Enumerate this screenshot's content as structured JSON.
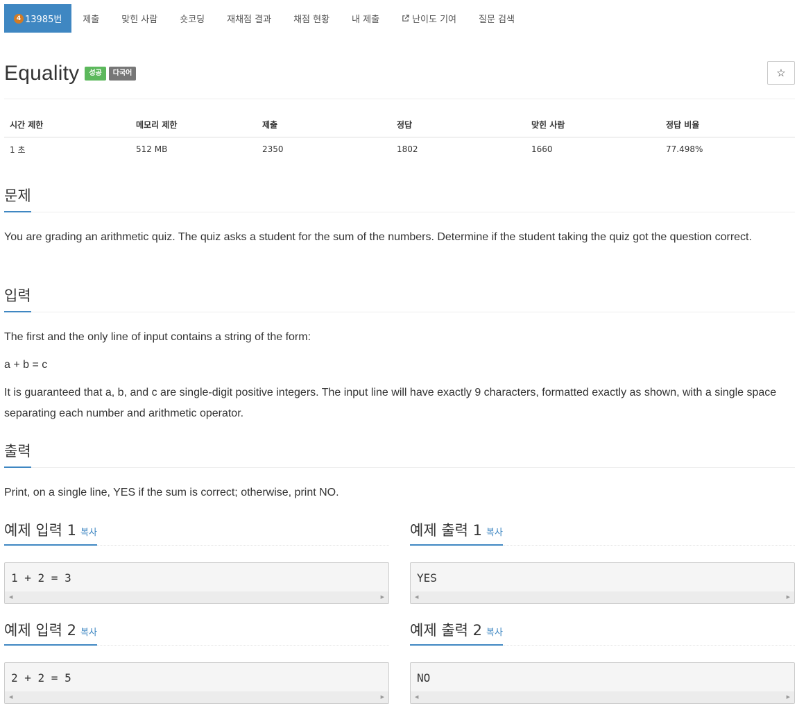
{
  "nav": {
    "problem_tier": "4",
    "problem_number": "13985번",
    "items": [
      "제출",
      "맞힌 사람",
      "숏코딩",
      "재채점 결과",
      "채점 현황",
      "내 제출",
      "난이도 기여",
      "질문 검색"
    ]
  },
  "title": "Equality",
  "labels": {
    "status": "성공",
    "language": "다국어"
  },
  "star": "☆",
  "info": {
    "headers": [
      "시간 제한",
      "메모리 제한",
      "제출",
      "정답",
      "맞힌 사람",
      "정답 비율"
    ],
    "values": [
      "1 초",
      "512 MB",
      "2350",
      "1802",
      "1660",
      "77.498%"
    ]
  },
  "problem": {
    "heading": "문제",
    "text": "You are grading an arithmetic quiz. The quiz asks a student for the sum of the numbers. Determine if the student taking the quiz got the question correct."
  },
  "input": {
    "heading": "입력",
    "p1": "The first and the only line of input contains a string of the form:",
    "p2": "a + b = c",
    "p3": "It is guaranteed that a, b, and c are single-digit positive integers. The input line will have exactly 9 characters, formatted exactly as shown, with a single space separating each number and arithmetic operator."
  },
  "output": {
    "heading": "출력",
    "text": "Print, on a single line, YES if the sum is correct; otherwise, print NO."
  },
  "samples": {
    "copy_label": "복사",
    "in1_title": "예제 입력 1",
    "in1": "1 + 2 = 3",
    "out1_title": "예제 출력 1",
    "out1": "YES",
    "in2_title": "예제 입력 2",
    "in2": "2 + 2 = 5",
    "out2_title": "예제 출력 2",
    "out2": "NO"
  },
  "colors": {
    "primary": "#3f87c2",
    "success": "#5cb85c",
    "language": "#777777",
    "tier_bronze": "#d27b25"
  }
}
